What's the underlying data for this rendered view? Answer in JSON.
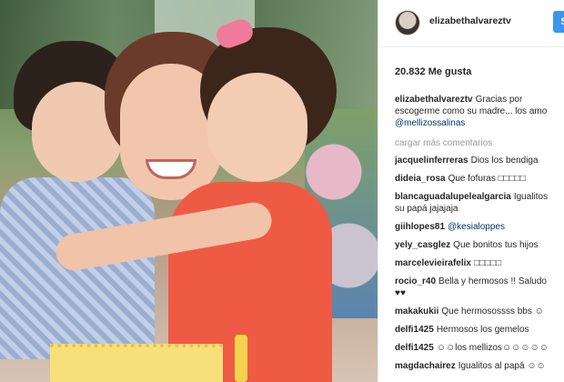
{
  "post": {
    "photo_icon": "family-photo"
  },
  "header": {
    "username": "elizabethalvareztv",
    "follow_label": "S"
  },
  "likes": "20.832 Me gusta",
  "caption": {
    "user": "elizabethalvareztv",
    "line1": "Gracias por",
    "line2": "escogerme como su madre... los amo",
    "mention": "@mellizossalinas"
  },
  "load_more": "cargar más comentarios",
  "comments": [
    {
      "user": "jacquelinferreras",
      "text": "Dios los bendiga"
    },
    {
      "user": "dideia_rosa",
      "text": "Que fofuras □□□□□"
    },
    {
      "user": "blancaguadalupelealgarcia",
      "text": "Igualitos",
      "text2": "su papá jajajaja"
    },
    {
      "user": "giihlopes81",
      "text": "@kesialoppes"
    },
    {
      "user": "yely_casglez",
      "text": "Que bonitos tus hijos"
    },
    {
      "user": "marcelevieirafelix",
      "text": "□□□□□"
    },
    {
      "user": "rocio_r40",
      "text": "Bella y hermosos !! Saludo",
      "text2": "♥♥"
    },
    {
      "user": "makakukii",
      "text": "Que hermosossss bbs ☺"
    },
    {
      "user": "delfi1425",
      "text": "Hermosos los gemelos"
    },
    {
      "user": "delfi1425",
      "text": "☺☺los mellizos☺☺☺☺☺"
    },
    {
      "user": "magdachairez",
      "text": "Igualitos al papá ☺☺"
    }
  ],
  "colors": {
    "accent": "#3897f0",
    "mention": "#003569",
    "muted": "#999999"
  }
}
